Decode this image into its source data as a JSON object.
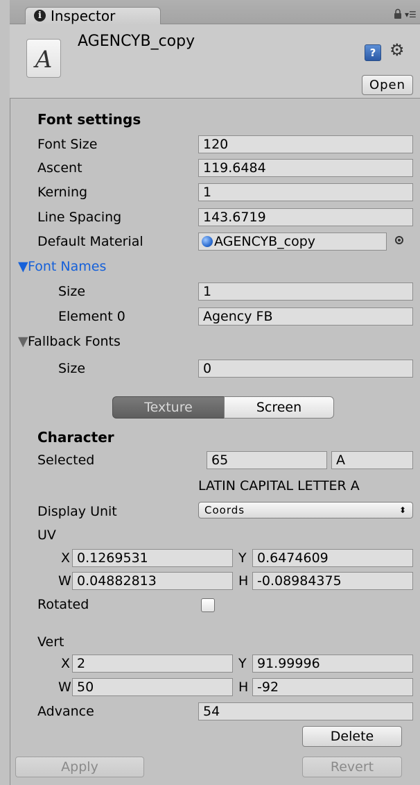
{
  "tab": {
    "label": "Inspector"
  },
  "header": {
    "asset_name": "AGENCYB_copy",
    "icon_letter": "A",
    "open_label": "Open"
  },
  "font_settings": {
    "heading": "Font settings",
    "font_size": {
      "label": "Font Size",
      "value": "120"
    },
    "ascent": {
      "label": "Ascent",
      "value": "119.6484"
    },
    "kerning": {
      "label": "Kerning",
      "value": "1"
    },
    "line_spacing": {
      "label": "Line Spacing",
      "value": "143.6719"
    },
    "default_material": {
      "label": "Default Material",
      "value": "AGENCYB_copy"
    }
  },
  "font_names": {
    "label": "Font Names",
    "size": {
      "label": "Size",
      "value": "1"
    },
    "element0": {
      "label": "Element 0",
      "value": "Agency FB"
    }
  },
  "fallback_fonts": {
    "label": "Fallback Fonts",
    "size": {
      "label": "Size",
      "value": "0"
    }
  },
  "view_toggle": {
    "texture": "Texture",
    "screen": "Screen",
    "selected": "Texture"
  },
  "character": {
    "heading": "Character",
    "selected": {
      "label": "Selected",
      "code": "65",
      "char": "A",
      "name": "LATIN CAPITAL LETTER A"
    },
    "display_unit": {
      "label": "Display Unit",
      "value": "Coords"
    },
    "uv": {
      "label": "UV",
      "x": {
        "label": "X",
        "value": "0.1269531"
      },
      "y": {
        "label": "Y",
        "value": "0.6474609"
      },
      "w": {
        "label": "W",
        "value": "0.04882813"
      },
      "h": {
        "label": "H",
        "value": "-0.08984375"
      }
    },
    "rotated": {
      "label": "Rotated",
      "checked": false
    },
    "vert": {
      "label": "Vert",
      "x": {
        "label": "X",
        "value": "2"
      },
      "y": {
        "label": "Y",
        "value": "91.99996"
      },
      "w": {
        "label": "W",
        "value": "50"
      },
      "h": {
        "label": "H",
        "value": "-92"
      }
    },
    "advance": {
      "label": "Advance",
      "value": "54"
    }
  },
  "buttons": {
    "delete": "Delete",
    "apply": "Apply",
    "revert": "Revert"
  },
  "colors": {
    "panel": "#c2c2c2",
    "field": "#dedede",
    "link_blue": "#1560d9",
    "toggle_active": "#6b6b6b"
  }
}
